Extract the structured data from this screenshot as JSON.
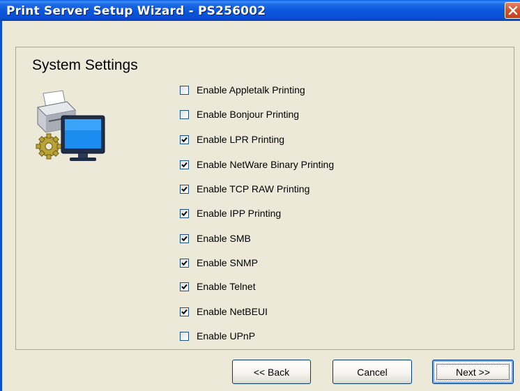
{
  "window": {
    "title": "Print Server Setup Wizard - PS256002",
    "close_icon": "close-icon"
  },
  "section": {
    "title": "System Settings",
    "icon": "printer-computer-settings-icon"
  },
  "checkboxes": [
    {
      "label": "Enable Appletalk Printing",
      "checked": false
    },
    {
      "label": "Enable Bonjour Printing",
      "checked": false
    },
    {
      "label": "Enable LPR Printing",
      "checked": true
    },
    {
      "label": "Enable NetWare Binary Printing",
      "checked": true
    },
    {
      "label": "Enable TCP RAW Printing",
      "checked": true
    },
    {
      "label": "Enable IPP Printing",
      "checked": true
    },
    {
      "label": "Enable SMB",
      "checked": true
    },
    {
      "label": "Enable SNMP",
      "checked": true
    },
    {
      "label": "Enable Telnet",
      "checked": true
    },
    {
      "label": "Enable NetBEUI",
      "checked": true
    },
    {
      "label": "Enable UPnP",
      "checked": false
    }
  ],
  "buttons": {
    "back": "<< Back",
    "cancel": "Cancel",
    "next": "Next >>"
  },
  "colors": {
    "titlebar": "#0A56DB",
    "window_background": "#ECE9D8",
    "close_button": "#D5542F"
  }
}
